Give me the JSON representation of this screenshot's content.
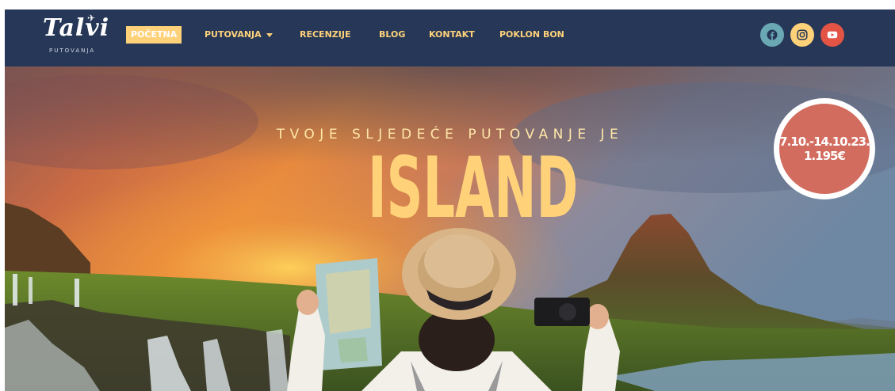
{
  "brand": {
    "logo_text": "Talvi",
    "logo_subtitle": "PUTOVANJA"
  },
  "nav": {
    "items": [
      {
        "label": "POČETNA",
        "active": true
      },
      {
        "label": "PUTOVANJA",
        "has_dropdown": true
      },
      {
        "label": "RECENZIJE"
      },
      {
        "label": "BLOG"
      },
      {
        "label": "KONTAKT"
      },
      {
        "label": "POKLON BON"
      }
    ],
    "social": [
      {
        "icon": "facebook-icon",
        "color": "#6aa8b4"
      },
      {
        "icon": "instagram-icon",
        "color": "#ffd27a"
      },
      {
        "icon": "youtube-icon",
        "color": "#e45445"
      }
    ]
  },
  "hero": {
    "tagline": "TVOJE SLJEDEĆE PUTOVANJE JE",
    "headline": "ISLAND",
    "badge": {
      "dates": "7.10.-14.10.23.",
      "price": "1.195€"
    }
  },
  "colors": {
    "nav_bg": "#263757",
    "accent_yellow": "#ffd27a",
    "badge_red": "#d26c5f"
  }
}
